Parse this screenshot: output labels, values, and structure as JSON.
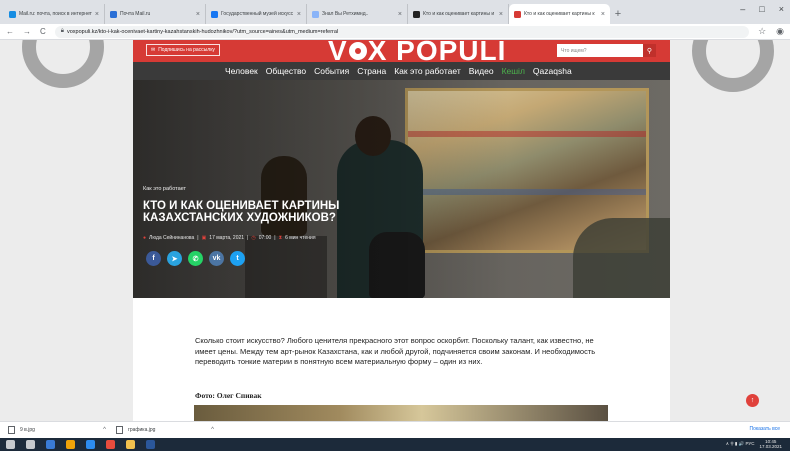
{
  "browser": {
    "tabs": [
      {
        "label": "Mail.ru: почта, поиск в интернет",
        "favicon_color": "#168de2",
        "active": false
      },
      {
        "label": "Почта Mail.ru",
        "favicon_color": "#2a6fd6",
        "active": false
      },
      {
        "label": "Государственный музей искусс",
        "favicon_color": "#1877f2",
        "active": false
      },
      {
        "label": "Знал Вы Ретхимнд..",
        "favicon_color": "#8ab4f8",
        "active": false
      },
      {
        "label": "Кто и как оценивает картины и",
        "favicon_color": "#222222",
        "active": false
      },
      {
        "label": "Кто и как оценивает картины к",
        "favicon_color": "#d63a35",
        "active": true
      }
    ],
    "tab_close": "×",
    "new_tab": "+",
    "window_controls": {
      "minimize": "–",
      "maximize": "□",
      "close": "×"
    },
    "nav": {
      "back": "←",
      "forward": "→",
      "reload": "C"
    },
    "url": "voxpopuli.kz/kto-i-kak-ocenivaet-kartiny-kazahstanskih-hudozhnikov/?utm_source=aines&utm_medium=referral",
    "star": "☆",
    "profile": "◉"
  },
  "header": {
    "subscribe_label": "Подпишись на рассылку",
    "logo_left": "V",
    "logo_right": "X POPULI",
    "search_placeholder": "Что ищем?",
    "search_icon": "search-icon"
  },
  "nav": {
    "items": [
      {
        "label": "Человек",
        "highlight": false
      },
      {
        "label": "Общество",
        "highlight": false
      },
      {
        "label": "События",
        "highlight": false
      },
      {
        "label": "Страна",
        "highlight": false
      },
      {
        "label": "Как это работает",
        "highlight": false
      },
      {
        "label": "Видео",
        "highlight": false
      },
      {
        "label": "Кешіл",
        "highlight": true
      },
      {
        "label": "Qazaqsha",
        "highlight": false
      }
    ]
  },
  "article": {
    "category": "Как это работает",
    "title": "КТО И КАК ОЦЕНИВАЕТ КАРТИНЫ КАЗАХСТАНСКИХ ХУДОЖНИКОВ?",
    "author": "Люда Сейнинанова",
    "date": "17 марта, 2021",
    "time": "07:00",
    "read_time": "6 мин чтения",
    "share_buttons": [
      {
        "name": "facebook",
        "glyph": "f",
        "color": "#3b5998"
      },
      {
        "name": "telegram",
        "glyph": "➤",
        "color": "#2aa3df"
      },
      {
        "name": "whatsapp",
        "glyph": "✆",
        "color": "#25d366"
      },
      {
        "name": "vk",
        "glyph": "vk",
        "color": "#4c75a3"
      },
      {
        "name": "twitter",
        "glyph": "t",
        "color": "#1da1f2"
      }
    ],
    "intro": "Сколько стоит искусство? Любого ценителя прекрасного этот вопрос оскорбит. Поскольку талант, как известно, не имеет цены. Между тем арт-рынок Казахстана, как и любой другой, подчиняется своим законам. И необходимость переводить тонкие материи в понятную всем материальную форму – один из них.",
    "photo_credit": "Фото: Олег Спивак"
  },
  "scroll_top_icon": "↑",
  "downloads": {
    "items": [
      {
        "name": "9 в.jpg"
      },
      {
        "name": "графика.jpg"
      }
    ],
    "chevron": "^",
    "show_all": "Показать все"
  },
  "taskbar": {
    "apps": [
      "#ffffff",
      "#ffffff",
      "#3a7bd5",
      "#f0a30a",
      "#2d8cf0",
      "#e84c3d",
      "#f2c14e",
      "#2b579a"
    ],
    "tray_text": "∧ ⚲ ▮ 🔊 РУС",
    "time": "10:45",
    "date": "17.03.2021"
  }
}
